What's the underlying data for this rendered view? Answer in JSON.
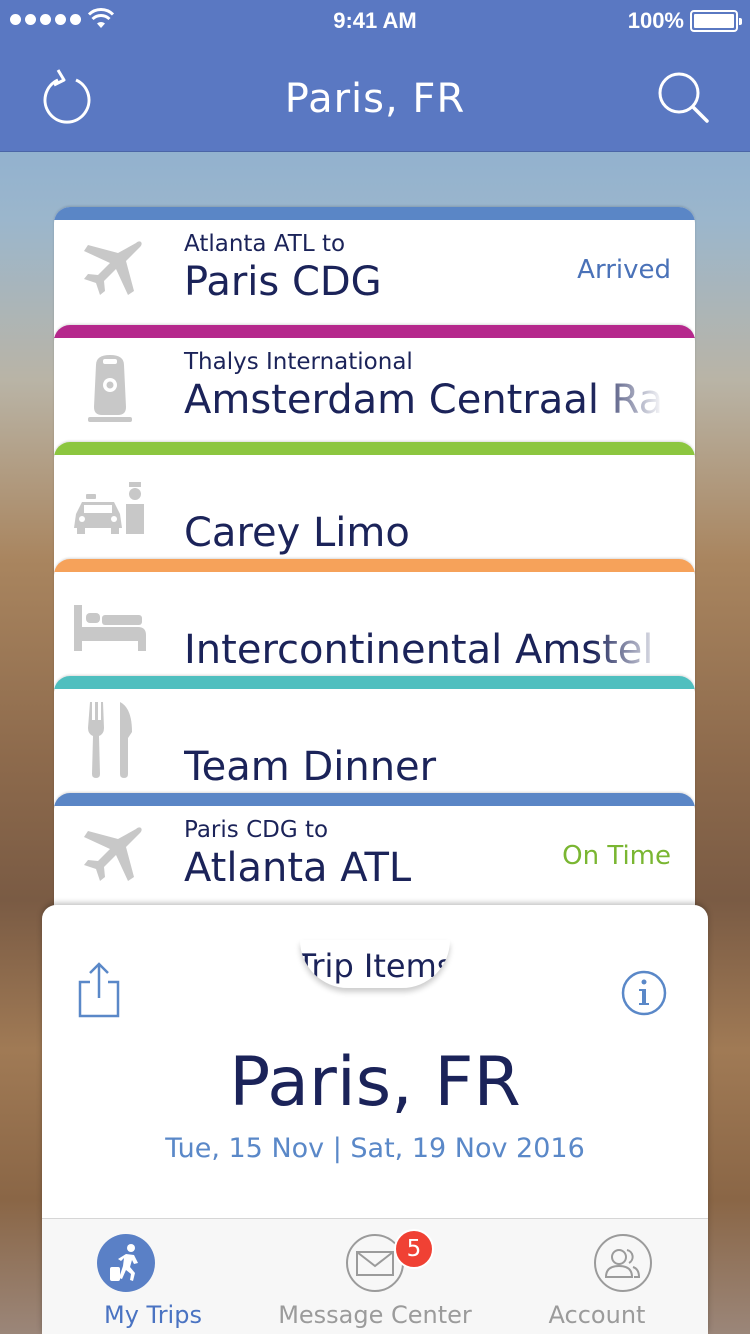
{
  "status_bar": {
    "time": "9:41 AM",
    "battery": "100%"
  },
  "header": {
    "title": "Paris, FR"
  },
  "trip_items": [
    {
      "subtitle": "Atlanta ATL to",
      "title": "Paris CDG",
      "status": "Arrived",
      "stripe_color": "#5a86c6",
      "status_color": "#4a72b8",
      "icon": "airplane-icon"
    },
    {
      "subtitle": "Thalys International",
      "title": "Amsterdam Centraal Rail",
      "status": "",
      "stripe_color": "#b5288c",
      "icon": "train-icon"
    },
    {
      "subtitle": "",
      "title": "Carey Limo",
      "status": "",
      "stripe_color": "#8cc63f",
      "icon": "limo-icon"
    },
    {
      "subtitle": "",
      "title": "Intercontinental Amstel",
      "status": "",
      "stripe_color": "#f6a25a",
      "icon": "bed-icon"
    },
    {
      "subtitle": "",
      "title": "Team Dinner",
      "status": "",
      "stripe_color": "#4fbfbf",
      "icon": "fork-knife-icon"
    },
    {
      "subtitle": "Paris CDG to",
      "title": "Atlanta ATL",
      "status": "On Time",
      "stripe_color": "#5a86c6",
      "status_color": "#7ab632",
      "icon": "airplane-icon"
    }
  ],
  "pocket": {
    "tab_label": "Trip Items",
    "city": "Paris, FR",
    "dates": "Tue, 15 Nov | Sat, 19 Nov 2016"
  },
  "tab_bar": {
    "tabs": [
      {
        "label": "My Trips",
        "icon": "traveler-icon",
        "active": true
      },
      {
        "label": "Message Center",
        "icon": "envelope-icon",
        "active": false,
        "badge": "5"
      },
      {
        "label": "Account",
        "icon": "person-icon",
        "active": false
      }
    ]
  }
}
